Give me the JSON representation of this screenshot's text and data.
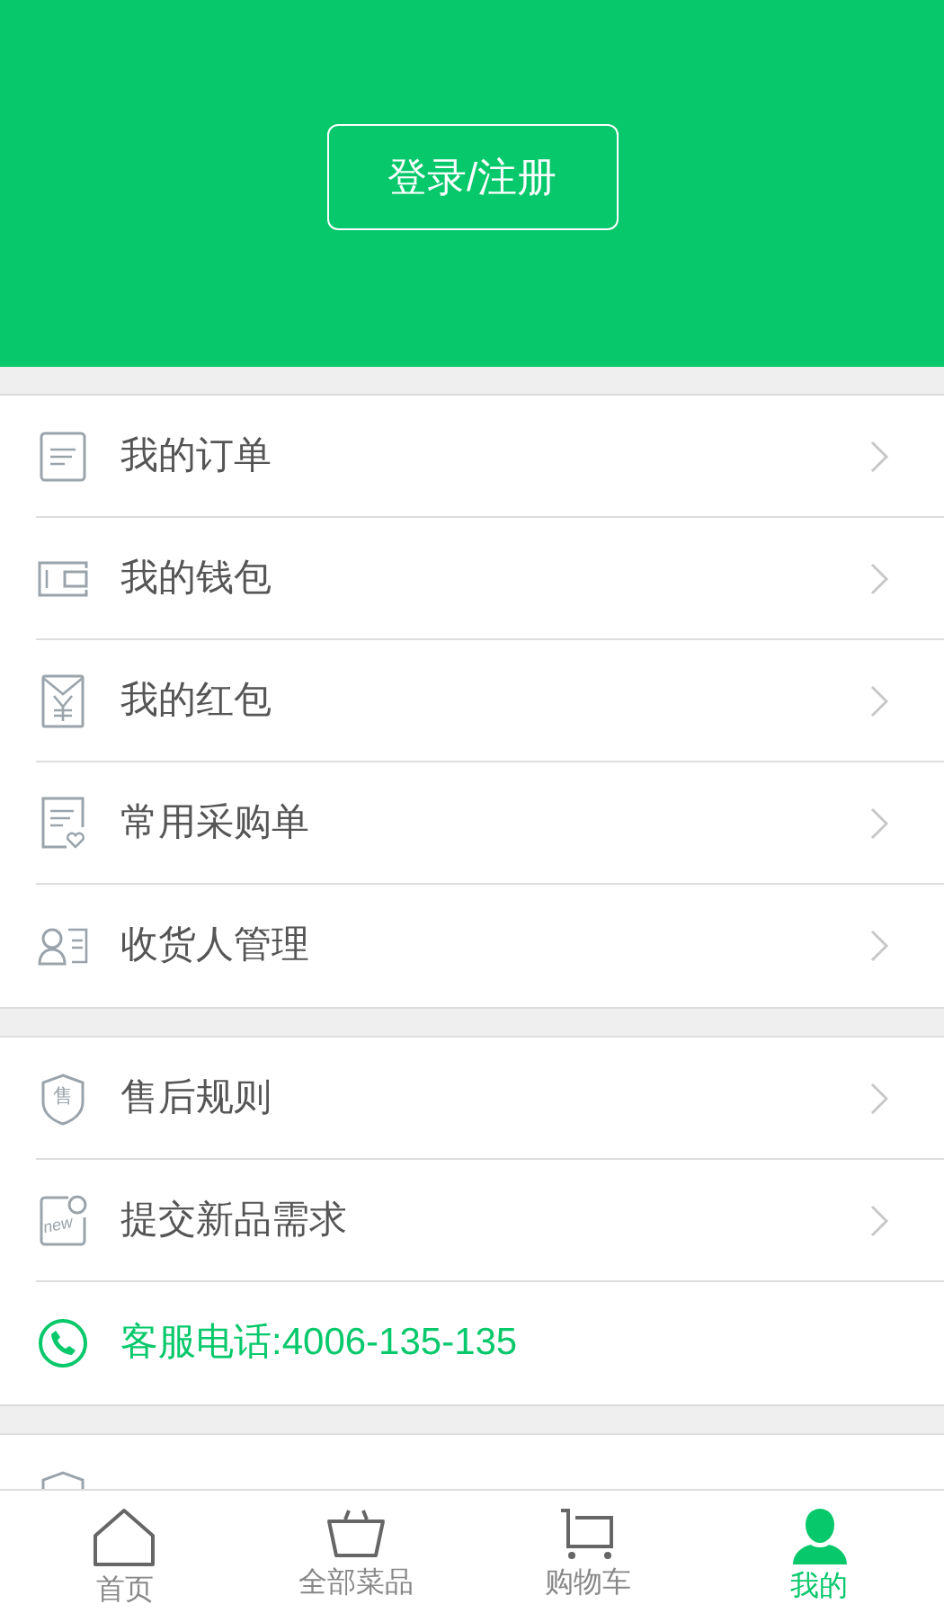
{
  "header": {
    "login_button": "登录/注册"
  },
  "groups": [
    {
      "items": [
        {
          "kind": "order",
          "label": "我的订单",
          "chevron": true,
          "highlight": false
        },
        {
          "kind": "wallet",
          "label": "我的钱包",
          "chevron": true,
          "highlight": false
        },
        {
          "kind": "redpacket",
          "label": "我的红包",
          "chevron": true,
          "highlight": false
        },
        {
          "kind": "list",
          "label": "常用采购单",
          "chevron": true,
          "highlight": false
        },
        {
          "kind": "contact",
          "label": "收货人管理",
          "chevron": true,
          "highlight": false
        }
      ]
    },
    {
      "items": [
        {
          "kind": "shield",
          "label": "售后规则",
          "chevron": true,
          "icon_text": "售",
          "highlight": false
        },
        {
          "kind": "new",
          "label": "提交新品需求",
          "chevron": true,
          "icon_text": "new",
          "highlight": false
        },
        {
          "kind": "phone",
          "label": "客服电话:4006-135-135",
          "chevron": false,
          "highlight": true
        }
      ]
    },
    {
      "items": [
        {
          "kind": "terms"
        }
      ]
    }
  ],
  "tab_bar": [
    {
      "kind": "home",
      "label": "首页",
      "selected": false
    },
    {
      "kind": "basket",
      "label": "全部菜品",
      "selected": false
    },
    {
      "kind": "cart",
      "label": "购物车",
      "selected": false
    },
    {
      "kind": "user",
      "label": "我的",
      "selected": true
    }
  ]
}
